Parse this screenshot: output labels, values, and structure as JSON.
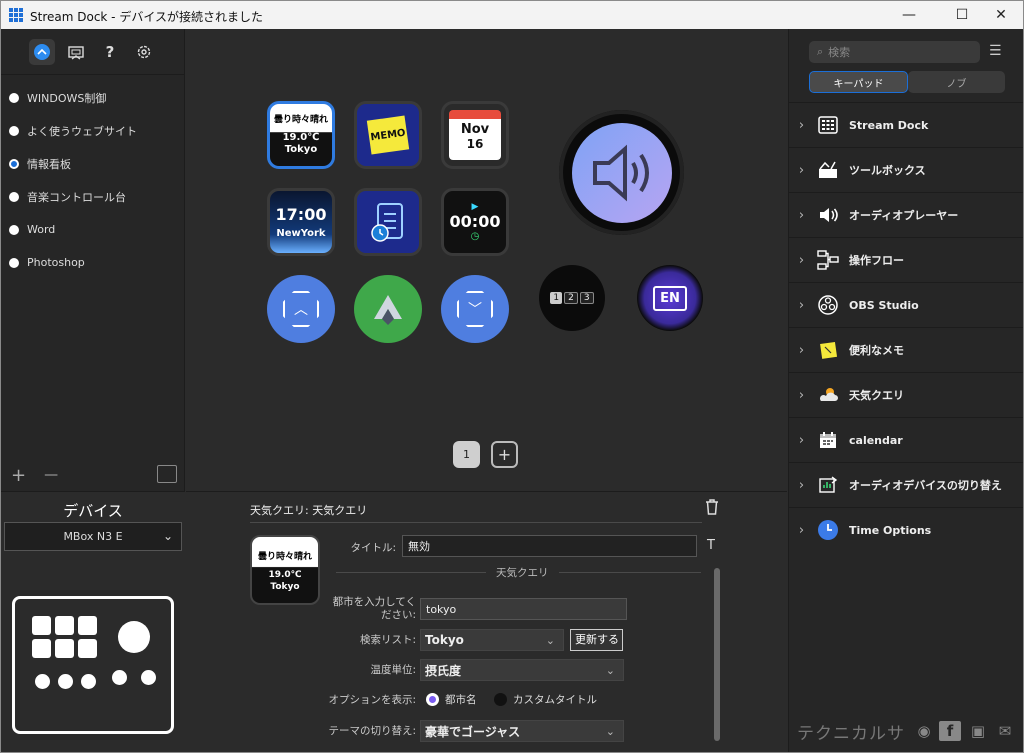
{
  "window": {
    "title": "Stream Dock - デバイスが接続されました",
    "minimize": "—",
    "maximize": "☐",
    "close": "✕"
  },
  "toolbar": {
    "help_label": "?",
    "settings_label": "⚙"
  },
  "profiles": [
    {
      "label": "WINDOWS制御",
      "selected": false
    },
    {
      "label": "よく使うウェブサイト",
      "selected": false
    },
    {
      "label": "情報看板",
      "selected": true
    },
    {
      "label": "音楽コントロール台",
      "selected": false
    },
    {
      "label": "Word",
      "selected": false
    },
    {
      "label": "Photoshop",
      "selected": false
    }
  ],
  "profile_actions": {
    "add": "+",
    "remove": "—"
  },
  "device": {
    "heading": "デバイス",
    "model": "MBox N3 E"
  },
  "keys": {
    "weather": {
      "line1": "曇り時々晴れ",
      "line2": "19.0℃",
      "line3": "Tokyo"
    },
    "memo": {
      "label": "MEMO"
    },
    "calendar": {
      "month": "Nov",
      "day": "16"
    },
    "clock": {
      "time": "17:00",
      "city": "NewYork"
    },
    "timer": {
      "time": "00:00"
    },
    "numpad": {
      "digits": [
        "1",
        "2",
        "3"
      ]
    },
    "lang": {
      "label": "EN"
    }
  },
  "pages": {
    "current": "1",
    "add": "+"
  },
  "properties": {
    "header": "天気クエリ: 天気クエリ",
    "title_label": "タイトル:",
    "title_value": "無効",
    "title_t": "T",
    "section": "天気クエリ",
    "city_label": "都市を入力してください:",
    "city_value": "tokyo",
    "search_label": "検索リスト:",
    "search_value": "Tokyo",
    "refresh_button": "更新する",
    "unit_label": "温度単位:",
    "unit_value": "摂氏度",
    "display_label": "オプションを表示:",
    "display_opt1": "都市名",
    "display_opt2": "カスタムタイトル",
    "theme_label": "テーマの切り替え:",
    "theme_value": "豪華でゴージャス"
  },
  "sidebar": {
    "search_placeholder": "検索",
    "tabs": [
      "キーパッド",
      "ノブ"
    ],
    "plugins": [
      {
        "label": "Stream Dock",
        "icon": "grid-icon"
      },
      {
        "label": "ツールボックス",
        "icon": "toolbox-icon"
      },
      {
        "label": "オーディオプレーヤー",
        "icon": "speaker-icon"
      },
      {
        "label": "操作フロー",
        "icon": "flow-icon"
      },
      {
        "label": "OBS Studio",
        "icon": "obs-icon"
      },
      {
        "label": "便利なメモ",
        "icon": "memo-icon"
      },
      {
        "label": "天気クエリ",
        "icon": "weather-icon"
      },
      {
        "label": "calendar",
        "icon": "calendar-icon"
      },
      {
        "label": "オーディオデバイスの切り替え",
        "icon": "audio-switch-icon"
      },
      {
        "label": "Time Options",
        "icon": "clock-icon"
      }
    ],
    "brand": "テクニカルサ"
  }
}
